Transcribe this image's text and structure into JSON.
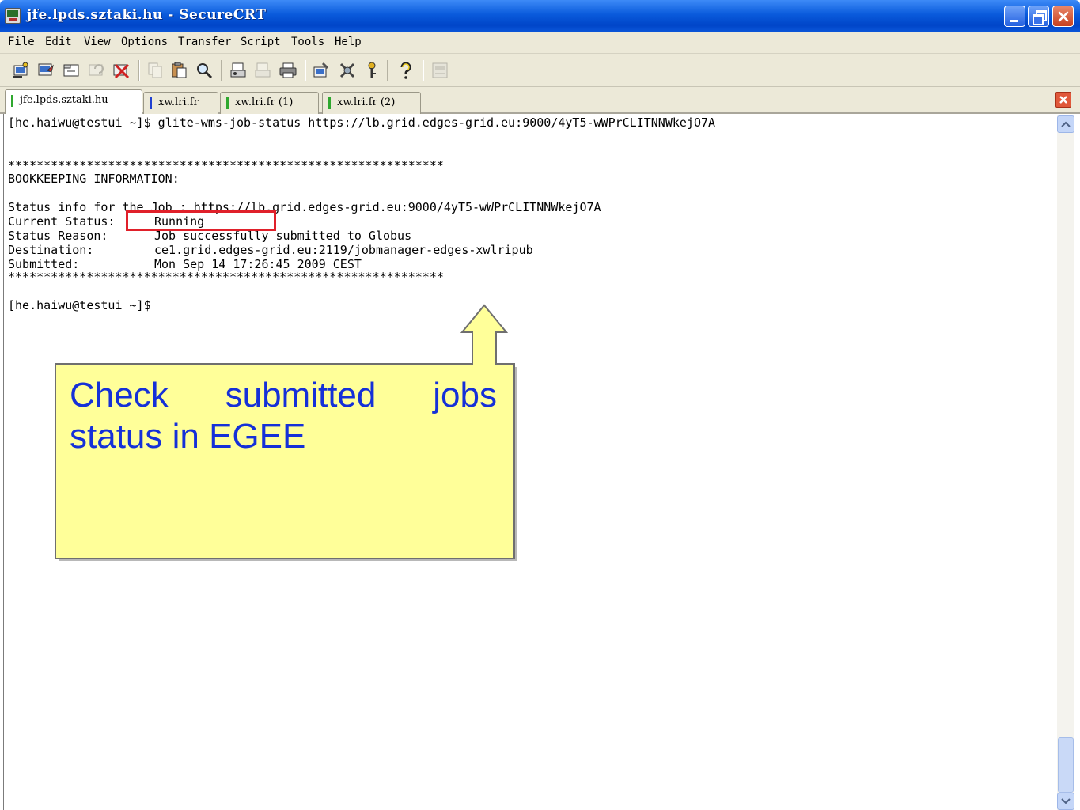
{
  "window": {
    "title": "jfe.lpds.sztaki.hu - SecureCRT"
  },
  "menu": {
    "items": [
      "File",
      "Edit",
      "View",
      "Options",
      "Transfer",
      "Script",
      "Tools",
      "Help"
    ]
  },
  "toolbar": {
    "icons": [
      "connect-icon",
      "quick-connect-icon",
      "connect-in-tab-icon",
      "reconnect-icon",
      "disconnect-icon",
      "copy-icon",
      "paste-icon",
      "find-icon",
      "print-setup-icon",
      "print-selection-icon",
      "print-icon",
      "session-options-icon",
      "global-options-icon",
      "keymap-icon",
      "help-icon",
      "sftp-icon"
    ]
  },
  "tabs": [
    {
      "label": "jfe.lpds.sztaki.hu",
      "active": true,
      "indicator": "#2fa82f"
    },
    {
      "label": "xw.lri.fr",
      "active": false,
      "indicator": "#2040d0"
    },
    {
      "label": "xw.lri.fr (1)",
      "active": false,
      "indicator": "#2fa82f"
    },
    {
      "label": "xw.lri.fr (2)",
      "active": false,
      "indicator": "#2fa82f"
    }
  ],
  "terminal": {
    "command_line": "[he.haiwu@testui ~]$ glite-wms-job-status https://lb.grid.edges-grid.eu:9000/4yT5-wWPrCLITNNWkejO7A",
    "stars": "*************************************************************",
    "bookkeeping": "BOOKKEEPING INFORMATION:",
    "status_info": "Status info for the Job : https://lb.grid.edges-grid.eu:9000/4yT5-wWPrCLITNNWkejO7A",
    "fields": [
      {
        "label": "Current Status:",
        "value": "Running"
      },
      {
        "label": "Status Reason:",
        "value": "Job successfully submitted to Globus"
      },
      {
        "label": "Destination:",
        "value": "ce1.grid.edges-grid.eu:2119/jobmanager-edges-xwlripub"
      },
      {
        "label": "Submitted:",
        "value": "Mon Sep 14 17:26:45 2009 CEST"
      }
    ],
    "prompt": "[he.haiwu@testui ~]$"
  },
  "callout": {
    "words_line1": [
      "Check",
      "submitted",
      "jobs"
    ],
    "line2": "status in EGEE",
    "fill": "#ffff99",
    "text_color": "#1530d8"
  },
  "colors": {
    "highlight": "#e0202a"
  }
}
